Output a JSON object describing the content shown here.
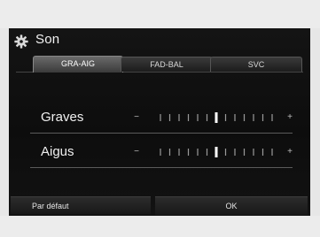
{
  "header": {
    "title": "Son",
    "icon": "gear-icon"
  },
  "tabs": [
    {
      "label": "GRA-AIG",
      "active": true
    },
    {
      "label": "FAD-BAL",
      "active": false
    },
    {
      "label": "SVC",
      "active": false
    }
  ],
  "settings": [
    {
      "label": "Graves",
      "minus": "−",
      "plus": "+",
      "level": 0,
      "min": -6,
      "max": 6
    },
    {
      "label": "Aigus",
      "minus": "−",
      "plus": "+",
      "level": 0,
      "min": -6,
      "max": 6
    }
  ],
  "buttons": {
    "default_label": "Par défaut",
    "ok_label": "OK"
  },
  "colors": {
    "screen_bg": "#121212",
    "frame_bg": "#ececec",
    "text": "#f0f0f0",
    "tick": "#9a9a9a",
    "tick_center": "#ffffff"
  }
}
